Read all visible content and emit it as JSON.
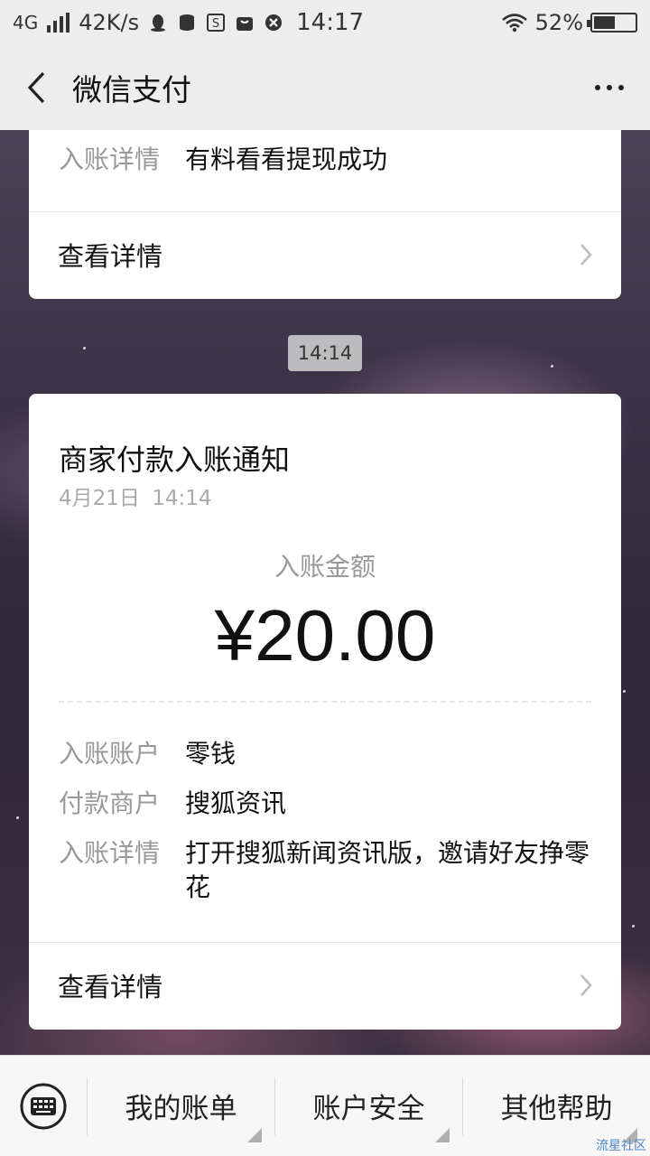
{
  "status_bar": {
    "network": "4G",
    "speed": "42K/s",
    "time": "14:17",
    "battery": "52%",
    "battery_level": 0.52
  },
  "nav": {
    "title": "微信支付"
  },
  "top_card": {
    "label": "入账详情",
    "value": "有料看看提现成功",
    "detail_link": "查看详情"
  },
  "timestamp": "14:14",
  "notification": {
    "title": "商家付款入账通知",
    "date": "4月21日",
    "time": "14:14",
    "amount_label": "入账金额",
    "amount": "¥20.00",
    "rows": [
      {
        "label": "入账账户",
        "value": "零钱"
      },
      {
        "label": "付款商户",
        "value": "搜狐资讯"
      },
      {
        "label": "入账详情",
        "value": "打开搜狐新闻资讯版，邀请好友挣零花"
      }
    ],
    "detail_link": "查看详情"
  },
  "bottom_menu": {
    "items": [
      "我的账单",
      "账户安全",
      "其他帮助"
    ]
  },
  "watermark": "流星社区",
  "colors": {
    "bar_bg": "#ededed",
    "card_bg": "#ffffff",
    "label_gray": "#999999",
    "text_dark": "#111111"
  }
}
